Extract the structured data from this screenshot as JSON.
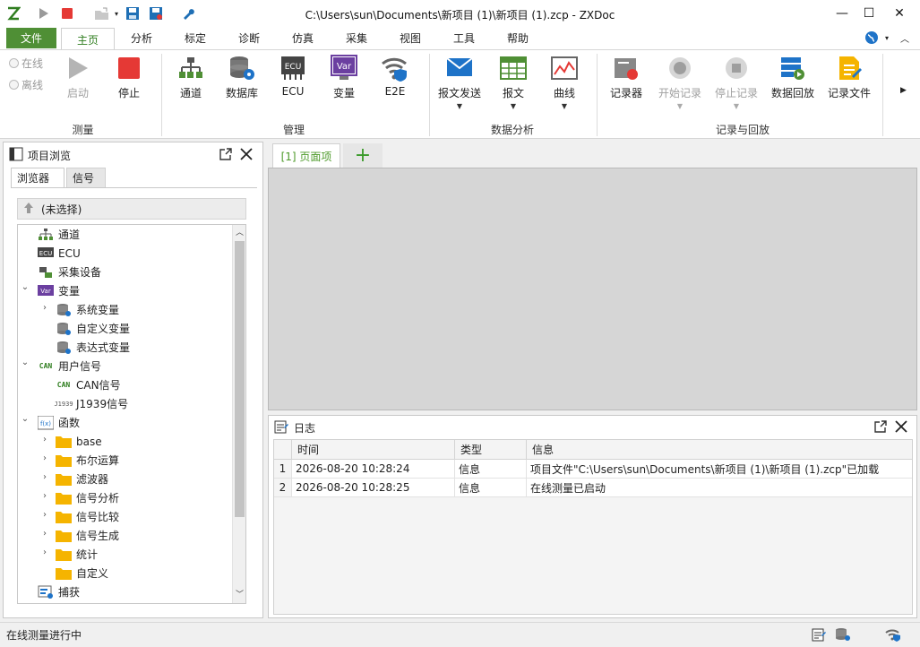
{
  "window": {
    "title": "C:\\Users\\sun\\Documents\\新项目 (1)\\新项目 (1).zcp - ZXDoc",
    "minimize_glyph": "—",
    "maximize_glyph": "☐",
    "close_glyph": "✕"
  },
  "colors": {
    "accent_green": "#4f8f35",
    "record_red": "#e53935",
    "doc_area": "#d6d6d6"
  },
  "ribbon": {
    "file_tab": "文件",
    "tabs": [
      "主页",
      "分析",
      "标定",
      "诊断",
      "仿真",
      "采集",
      "视图",
      "工具",
      "帮助"
    ],
    "mode": {
      "online": "在线",
      "offline": "离线"
    },
    "groups": {
      "measure": "测量",
      "manage": "管理",
      "analysis": "数据分析",
      "record": "记录与回放"
    },
    "buttons": {
      "start": "启动",
      "stop": "停止",
      "channel": "通道",
      "database": "数据库",
      "ecu": "ECU",
      "variable": "变量",
      "e2e": "E2E",
      "msg_send": "报文发送",
      "message": "报文",
      "curve": "曲线",
      "recorder": "记录器",
      "start_record": "开始记录",
      "stop_record": "停止记录",
      "replay": "数据回放",
      "record_file": "记录文件"
    },
    "icon_text": {
      "ecu": "ECU",
      "var": "Var"
    }
  },
  "project_panel": {
    "title": "项目浏览",
    "tabs": [
      "浏览器",
      "信号"
    ],
    "no_selection": "(未选择)",
    "tree": {
      "channel": "通道",
      "ecu": "ECU",
      "device": "采集设备",
      "variable": "变量",
      "sys_var": "系统变量",
      "custom_var": "自定义变量",
      "expr_var": "表达式变量",
      "user_signal": "用户信号",
      "can_signal": "CAN信号",
      "j1939_signal": "J1939信号",
      "function": "函数",
      "f_base": "base",
      "f_bool": "布尔运算",
      "f_filter": "滤波器",
      "f_analysis": "信号分析",
      "f_compare": "信号比较",
      "f_gen": "信号生成",
      "f_stat": "统计",
      "f_custom": "自定义",
      "capture": "捕获"
    },
    "icon_text": {
      "ecu": "ECU",
      "can": "CAN",
      "j1939": "J1939",
      "var": "Var",
      "fx": "f(x)"
    }
  },
  "document": {
    "tab_label": "[1] 页面项",
    "add_label": "+"
  },
  "log": {
    "title": "日志",
    "columns": [
      "时间",
      "类型",
      "信息"
    ],
    "rows": [
      {
        "num": "1",
        "time": "2026-08-20 10:28:24",
        "type": "信息",
        "info": "项目文件\"C:\\Users\\sun\\Documents\\新项目 (1)\\新项目 (1).zcp\"已加载"
      },
      {
        "num": "2",
        "time": "2026-08-20 10:28:25",
        "type": "信息",
        "info": "在线测量已启动"
      }
    ]
  },
  "status": {
    "text": "在线测量进行中"
  }
}
